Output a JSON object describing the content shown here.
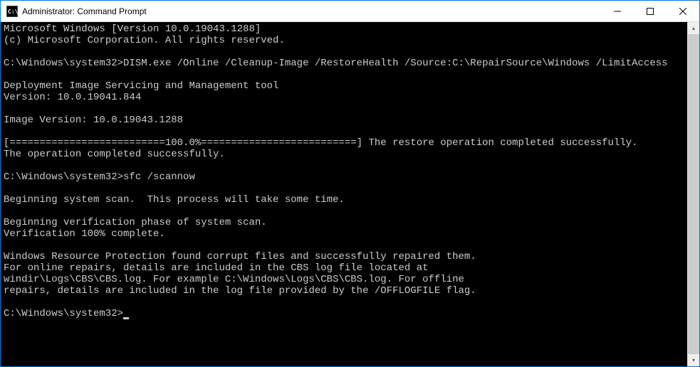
{
  "window": {
    "title": "Administrator: Command Prompt"
  },
  "terminal": {
    "line1": "Microsoft Windows [Version 10.0.19043.1288]",
    "line2": "(c) Microsoft Corporation. All rights reserved.",
    "blank1": "",
    "prompt1_path": "C:\\Windows\\system32>",
    "prompt1_cmd": "DISM.exe /Online /Cleanup-Image /RestoreHealth /Source:C:\\RepairSource\\Windows /LimitAccess",
    "blank2": "",
    "dism1": "Deployment Image Servicing and Management tool",
    "dism2": "Version: 10.0.19041.844",
    "blank3": "",
    "dism3": "Image Version: 10.0.19043.1288",
    "blank4": "",
    "progress": "[==========================100.0%==========================] The restore operation completed successfully.",
    "dism4": "The operation completed successfully.",
    "blank5": "",
    "prompt2_path": "C:\\Windows\\system32>",
    "prompt2_cmd": "sfc /scannow",
    "blank6": "",
    "sfc1": "Beginning system scan.  This process will take some time.",
    "blank7": "",
    "sfc2": "Beginning verification phase of system scan.",
    "sfc3": "Verification 100% complete.",
    "blank8": "",
    "sfc4": "Windows Resource Protection found corrupt files and successfully repaired them.",
    "sfc5": "For online repairs, details are included in the CBS log file located at",
    "sfc6": "windir\\Logs\\CBS\\CBS.log. For example C:\\Windows\\Logs\\CBS\\CBS.log. For offline",
    "sfc7": "repairs, details are included in the log file provided by the /OFFLOGFILE flag.",
    "blank9": "",
    "prompt3_path": "C:\\Windows\\system32>"
  }
}
